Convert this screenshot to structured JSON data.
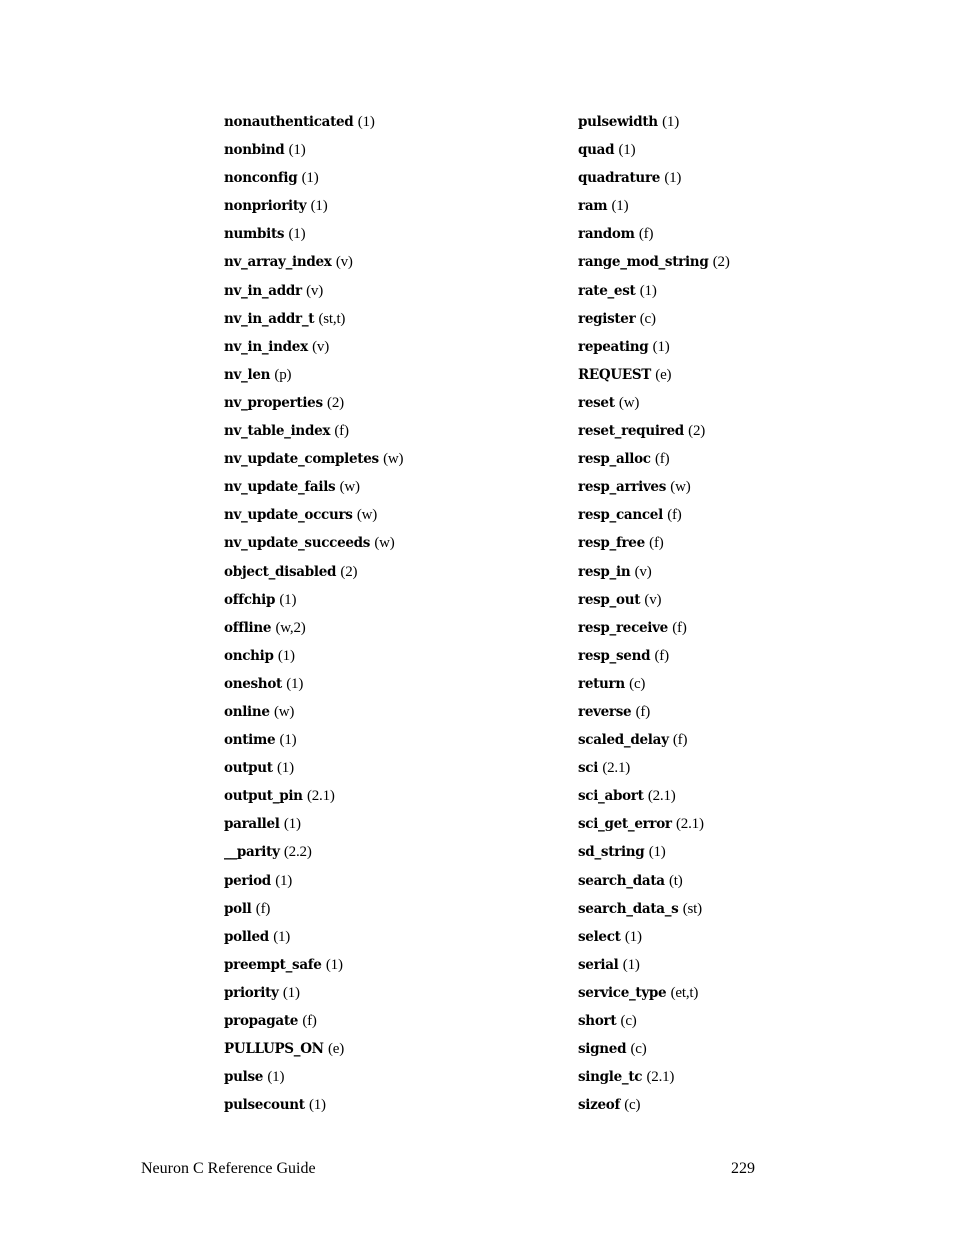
{
  "index": {
    "left_column": [
      {
        "term": "nonauthenticated",
        "code": "(1)"
      },
      {
        "term": "nonbind",
        "code": "(1)"
      },
      {
        "term": "nonconfig",
        "code": "(1)"
      },
      {
        "term": "nonpriority",
        "code": "(1)"
      },
      {
        "term": "numbits",
        "code": "(1)"
      },
      {
        "term": "nv_array_index",
        "code": "(v)"
      },
      {
        "term": "nv_in_addr",
        "code": "(v)"
      },
      {
        "term": "nv_in_addr_t",
        "code": "(st,t)"
      },
      {
        "term": "nv_in_index",
        "code": "(v)"
      },
      {
        "term": "nv_len",
        "code": "(p)"
      },
      {
        "term": "nv_properties",
        "code": "(2)"
      },
      {
        "term": "nv_table_index",
        "code": "(f)"
      },
      {
        "term": "nv_update_completes",
        "code": "(w)"
      },
      {
        "term": "nv_update_fails",
        "code": "(w)"
      },
      {
        "term": "nv_update_occurs",
        "code": "(w)"
      },
      {
        "term": "nv_update_succeeds",
        "code": "(w)"
      },
      {
        "term": "object_disabled",
        "code": "(2)"
      },
      {
        "term": "offchip",
        "code": "(1)"
      },
      {
        "term": "offline",
        "code": "(w,2)"
      },
      {
        "term": "onchip",
        "code": "(1)"
      },
      {
        "term": "oneshot",
        "code": "(1)"
      },
      {
        "term": "online",
        "code": "(w)"
      },
      {
        "term": "ontime",
        "code": "(1)"
      },
      {
        "term": "output",
        "code": "(1)"
      },
      {
        "term": "output_pin",
        "code": "(2.1)"
      },
      {
        "term": "parallel",
        "code": "(1)"
      },
      {
        "term": "__parity",
        "code": "(2.2)"
      },
      {
        "term": "period",
        "code": "(1)"
      },
      {
        "term": "poll",
        "code": "(f)"
      },
      {
        "term": "polled",
        "code": "(1)"
      },
      {
        "term": "preempt_safe",
        "code": "(1)"
      },
      {
        "term": "priority",
        "code": "(1)"
      },
      {
        "term": "propagate",
        "code": "(f)"
      },
      {
        "term": "PULLUPS_ON",
        "code": "(e)"
      },
      {
        "term": "pulse",
        "code": "(1)"
      },
      {
        "term": "pulsecount",
        "code": "(1)"
      }
    ],
    "right_column": [
      {
        "term": "pulsewidth",
        "code": "(1)"
      },
      {
        "term": "quad",
        "code": "(1)"
      },
      {
        "term": "quadrature",
        "code": "(1)"
      },
      {
        "term": "ram",
        "code": "(1)"
      },
      {
        "term": "random",
        "code": "(f)"
      },
      {
        "term": "range_mod_string",
        "code": "(2)"
      },
      {
        "term": "rate_est",
        "code": "(1)"
      },
      {
        "term": "register",
        "code": "(c)"
      },
      {
        "term": "repeating",
        "code": "(1)"
      },
      {
        "term": "REQUEST",
        "code": "(e)"
      },
      {
        "term": "reset",
        "code": "(w)"
      },
      {
        "term": "reset_required",
        "code": "(2)"
      },
      {
        "term": "resp_alloc",
        "code": "(f)"
      },
      {
        "term": "resp_arrives",
        "code": "(w)"
      },
      {
        "term": "resp_cancel",
        "code": "(f)"
      },
      {
        "term": "resp_free",
        "code": "(f)"
      },
      {
        "term": "resp_in",
        "code": "(v)"
      },
      {
        "term": "resp_out",
        "code": "(v)"
      },
      {
        "term": "resp_receive",
        "code": "(f)"
      },
      {
        "term": "resp_send",
        "code": "(f)"
      },
      {
        "term": "return",
        "code": "(c)"
      },
      {
        "term": "reverse",
        "code": "(f)"
      },
      {
        "term": "scaled_delay",
        "code": "(f)"
      },
      {
        "term": "sci",
        "code": "(2.1)"
      },
      {
        "term": "sci_abort",
        "code": "(2.1)"
      },
      {
        "term": "sci_get_error",
        "code": "(2.1)"
      },
      {
        "term": "sd_string",
        "code": "(1)"
      },
      {
        "term": "search_data",
        "code": "(t)"
      },
      {
        "term": "search_data_s",
        "code": "(st)"
      },
      {
        "term": "select",
        "code": "(1)"
      },
      {
        "term": "serial",
        "code": "(1)"
      },
      {
        "term": "service_type",
        "code": "(et,t)"
      },
      {
        "term": "short",
        "code": "(c)"
      },
      {
        "term": "signed",
        "code": "(c)"
      },
      {
        "term": "single_tc",
        "code": "(2.1)"
      },
      {
        "term": "sizeof",
        "code": "(c)"
      }
    ]
  },
  "footer": {
    "title": "Neuron C Reference Guide",
    "page_number": "229"
  }
}
